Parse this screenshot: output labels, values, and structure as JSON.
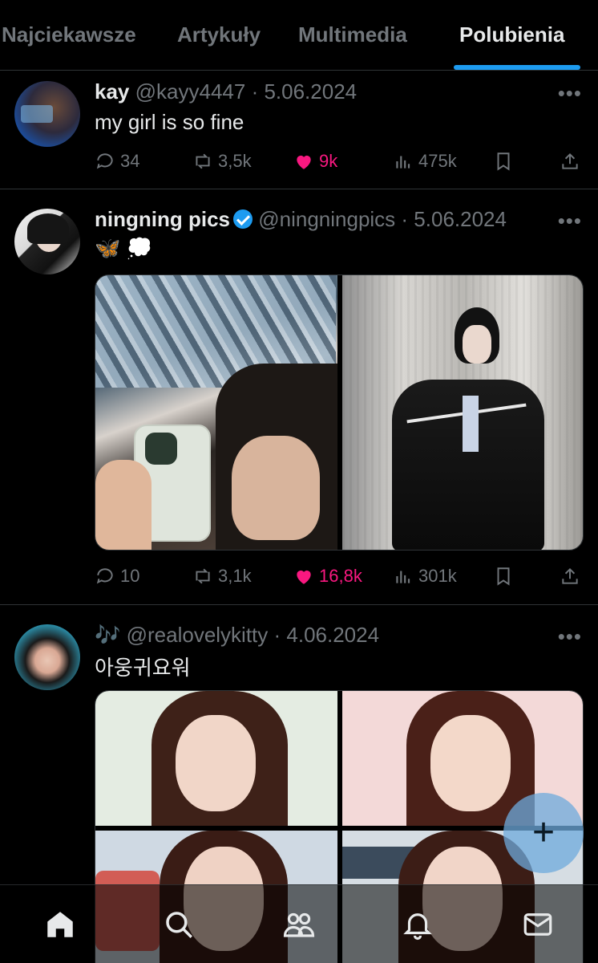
{
  "tabs": [
    {
      "label": "Najciekawsze",
      "active": false
    },
    {
      "label": "Artykuły",
      "active": false
    },
    {
      "label": "Multimedia",
      "active": false
    },
    {
      "label": "Polubienia",
      "active": true
    }
  ],
  "tweets": [
    {
      "name": "kay",
      "handle": "@kayy4447",
      "date": "· 5.06.2024",
      "text": "my girl is so fine",
      "replies": "34",
      "reposts": "3,5k",
      "likes": "9k",
      "views": "475k"
    },
    {
      "name": "ningning pics",
      "handle": "@ningningpics",
      "date": "· 5.06.2024",
      "text": "🦋 💭",
      "replies": "10",
      "reposts": "3,1k",
      "likes": "16,8k",
      "views": "301k",
      "verified": true
    },
    {
      "name": "🎶",
      "handle": "@realovelykitty",
      "date": "· 4.06.2024",
      "text": "아웅귀요워"
    }
  ],
  "more_label": "•••",
  "fab_label": "+",
  "colors": {
    "accent": "#1d9bf0",
    "like": "#f91880",
    "muted": "#71767b",
    "border": "#2f3336"
  },
  "icons": {
    "bottom_nav": [
      "home-icon",
      "search-icon",
      "communities-icon",
      "notifications-icon",
      "messages-icon"
    ],
    "actions": [
      "reply-icon",
      "repost-icon",
      "like-icon",
      "views-icon",
      "bookmark-icon",
      "share-icon"
    ]
  }
}
